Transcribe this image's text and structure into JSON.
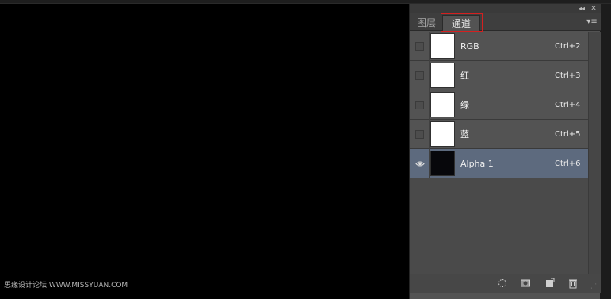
{
  "panel": {
    "tabs": [
      {
        "label": "图层",
        "active": false
      },
      {
        "label": "通道",
        "active": true
      }
    ],
    "collapse_icon": "double-chevron-left-icon",
    "close_icon": "close-icon",
    "menu_icon": "panel-menu-icon",
    "channels": [
      {
        "name": "RGB",
        "shortcut": "Ctrl+2",
        "visible": false,
        "selected": false,
        "thumb": "white"
      },
      {
        "name": "红",
        "shortcut": "Ctrl+3",
        "visible": false,
        "selected": false,
        "thumb": "white"
      },
      {
        "name": "绿",
        "shortcut": "Ctrl+4",
        "visible": false,
        "selected": false,
        "thumb": "white"
      },
      {
        "name": "蓝",
        "shortcut": "Ctrl+5",
        "visible": false,
        "selected": false,
        "thumb": "white"
      },
      {
        "name": "Alpha 1",
        "shortcut": "Ctrl+6",
        "visible": true,
        "selected": true,
        "thumb": "black"
      }
    ],
    "bottom_icons": [
      "load-selection-icon",
      "save-selection-icon",
      "new-channel-icon",
      "delete-channel-icon"
    ]
  },
  "watermark": "思缘设计论坛 WWW.MISSYUAN.COM",
  "colors": {
    "panel_bg": "#535353",
    "selected_row": "#5d6a7e",
    "tab_highlight": "#d42020",
    "canvas": "#000000"
  }
}
